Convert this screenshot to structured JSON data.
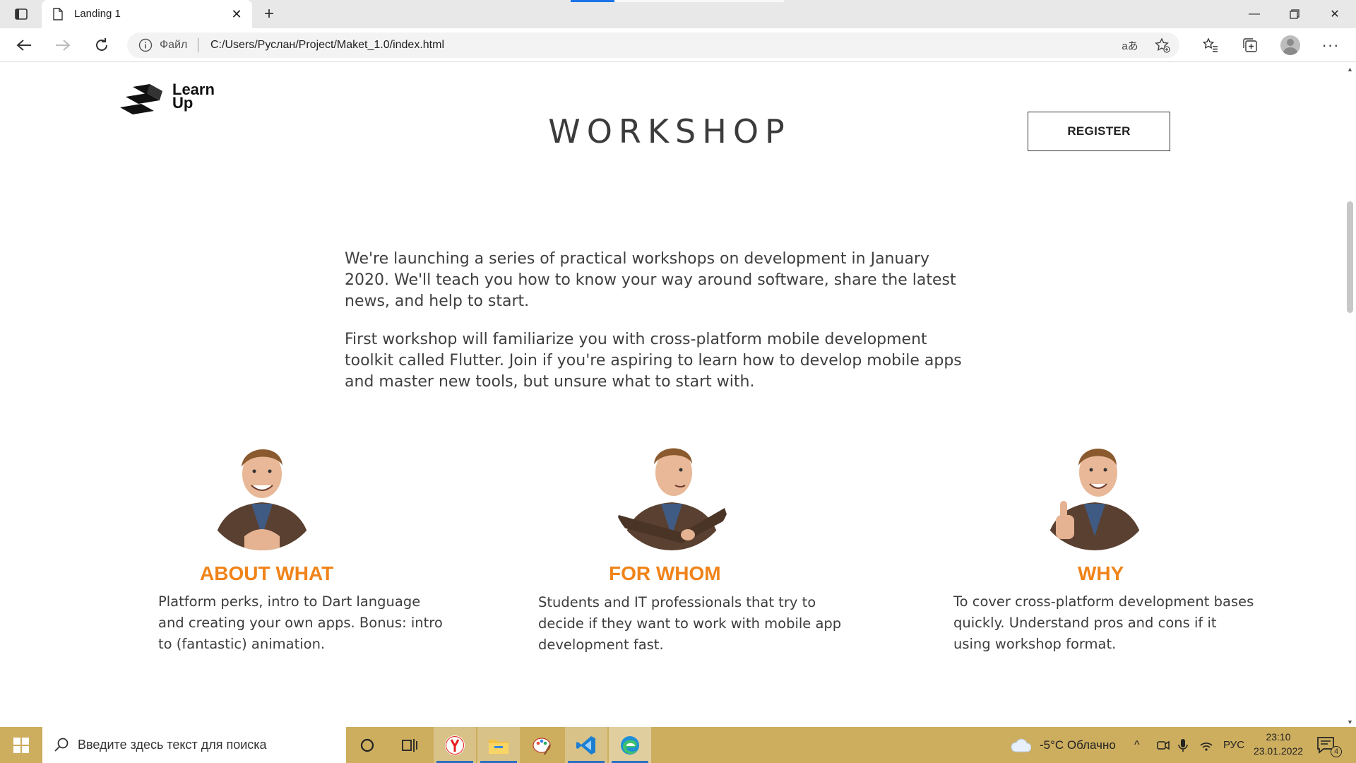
{
  "browser": {
    "tab_title": "Landing 1",
    "new_tab": "+",
    "scheme_label": "Файл",
    "url": "C:/Users/Руслан/Project/Maket_1.0/index.html"
  },
  "page": {
    "logo_line1": "Learn",
    "logo_line2": "Up",
    "title": "WORKSHOP",
    "register_label": "REGISTER",
    "intro": [
      "We're launching a series of practical workshops on development in January 2020. We'll teach you how to know your way around software, share the latest news, and help to start.",
      "First workshop will familiarize you with cross-platform mobile development toolkit called Flutter. Join if you're aspiring to learn how to develop mobile apps and master new tools, but unsure what to start with."
    ],
    "features": [
      {
        "title": "ABOUT WHAT",
        "text": "Platform perks, intro to Dart language and creating your own apps. Bonus: intro to (fantastic) animation."
      },
      {
        "title": "FOR WHOM",
        "text": "Students and IT professionals that try to decide if they want to work with mobile app development fast."
      },
      {
        "title": "WHY",
        "text": "To cover cross-platform development bases quickly. Understand pros and cons if it using workshop format."
      }
    ],
    "accent_color": "#f08319"
  },
  "taskbar": {
    "search_placeholder": "Введите здесь текст для поиска",
    "weather": "-5°C  Облачно",
    "language": "РУС",
    "time": "23:10",
    "date": "23.01.2022",
    "notification_count": "4",
    "color": "#cdae5f"
  }
}
